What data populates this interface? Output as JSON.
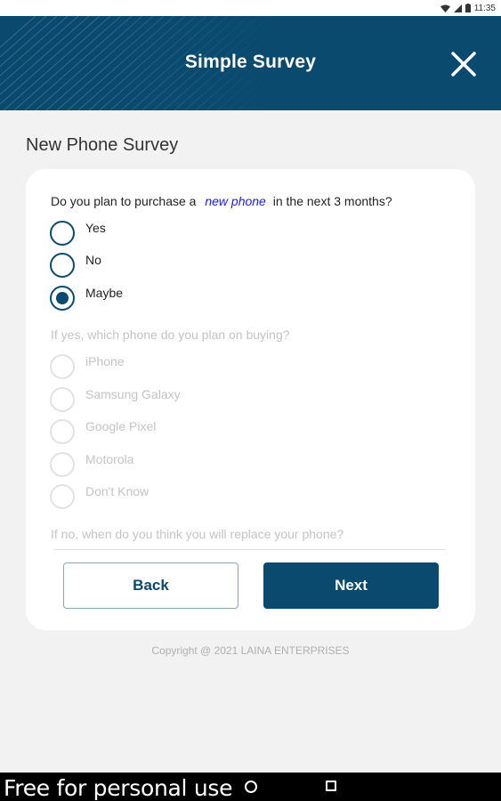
{
  "status_bar": {
    "time": "11:35"
  },
  "header": {
    "title": "Simple Survey",
    "close_icon": "close-icon"
  },
  "page": {
    "title": "New Phone Survey"
  },
  "survey": {
    "q1": {
      "prefix": "Do you plan to purchase a",
      "highlight": "new phone",
      "suffix": "in the next 3 months?",
      "options": [
        "Yes",
        "No",
        "Maybe"
      ],
      "selected": "Maybe"
    },
    "q2": {
      "text": "If yes, which phone do you plan on buying?",
      "options": [
        "iPhone",
        "Samsung Galaxy",
        "Google Pixel",
        "Motorola",
        "Don't Know"
      ]
    },
    "q3": {
      "text": "If no, when do you think you will replace your phone?"
    }
  },
  "buttons": {
    "back": "Back",
    "next": "Next"
  },
  "footer": {
    "copyright": "Copyright @ 2021 LAINA ENTERPRISES"
  },
  "nav_bar": {
    "watermark": "Free for personal use"
  },
  "colors": {
    "primary": "#0a4a6e",
    "highlight": "#1a1aff",
    "background": "#f2f2f2"
  }
}
